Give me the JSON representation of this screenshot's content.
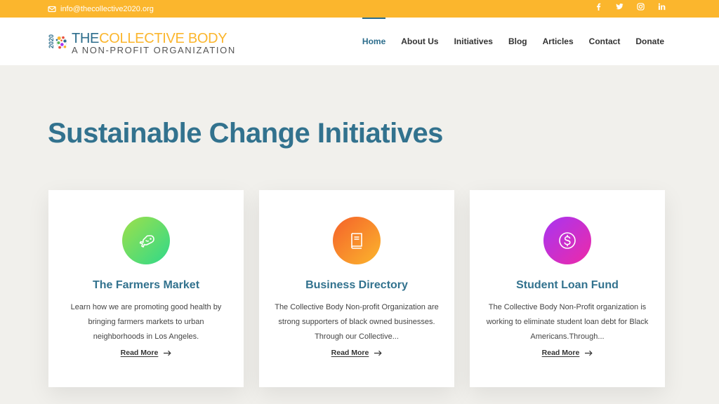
{
  "topbar": {
    "email": "info@thecollective2020.org",
    "social": [
      "facebook-icon",
      "twitter-icon",
      "instagram-icon",
      "linkedin-icon"
    ],
    "background": "#fbb62d"
  },
  "logo": {
    "year": "2020",
    "the": "THE",
    "name": "COLLECTIVE BODY",
    "tagline": "A NON-PROFIT ORGANIZATION"
  },
  "nav": {
    "items": [
      "Home",
      "About Us",
      "Initiatives",
      "Blog",
      "Articles",
      "Contact",
      "Donate"
    ],
    "active": "Home"
  },
  "main": {
    "title": "Sustainable Change Initiatives",
    "cards": [
      {
        "title": "The Farmers Market",
        "text": "Learn how we are promoting good health by bringing farmers markets to urban neighborhoods in Los Angeles.",
        "link": "Read More",
        "icon": "fish-icon",
        "gradient": [
          "#9ee04a",
          "#2fd98a"
        ]
      },
      {
        "title": "Business Directory",
        "text": "The Collective Body Non-profit Organization are strong supporters of black owned businesses. Through our Collective...",
        "link": "Read More",
        "icon": "book-icon",
        "gradient": [
          "#f5612a",
          "#fbb62d"
        ]
      },
      {
        "title": "Student Loan Fund",
        "text": "The Collective Body Non-Profit organization is working to eliminate student loan debt for Black Americans.Through...",
        "link": "Read More",
        "icon": "dollar-icon",
        "gradient": [
          "#a735f2",
          "#ee2aa7"
        ]
      }
    ]
  },
  "colors": {
    "primary": "#32728e",
    "accent": "#fbb62d",
    "background": "#f1f0ec"
  }
}
